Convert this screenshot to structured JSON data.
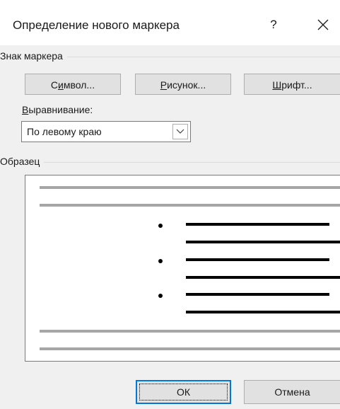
{
  "dialog": {
    "title": "Определение нового маркера",
    "help_label": "?",
    "close_icon": "close-icon"
  },
  "marker_group": {
    "label": "Знак маркера",
    "symbol_button": {
      "before": "С",
      "accel": "и",
      "after": "мвол..."
    },
    "picture_button": {
      "before": "",
      "accel": "Р",
      "after": "исунок..."
    },
    "font_button": {
      "before": "",
      "accel": "Ш",
      "after": "рифт..."
    },
    "alignment_label": {
      "before": "",
      "accel": "В",
      "after": "ыравнивание:"
    },
    "alignment_value": "По левому краю"
  },
  "preview_group": {
    "label": "Образец"
  },
  "footer": {
    "ok_label": "ОК",
    "cancel_label": "Отмена"
  },
  "colors": {
    "focus_border": "#0078d7",
    "preview_gray_line": "#a6a6a6",
    "preview_black_line": "#000000"
  }
}
